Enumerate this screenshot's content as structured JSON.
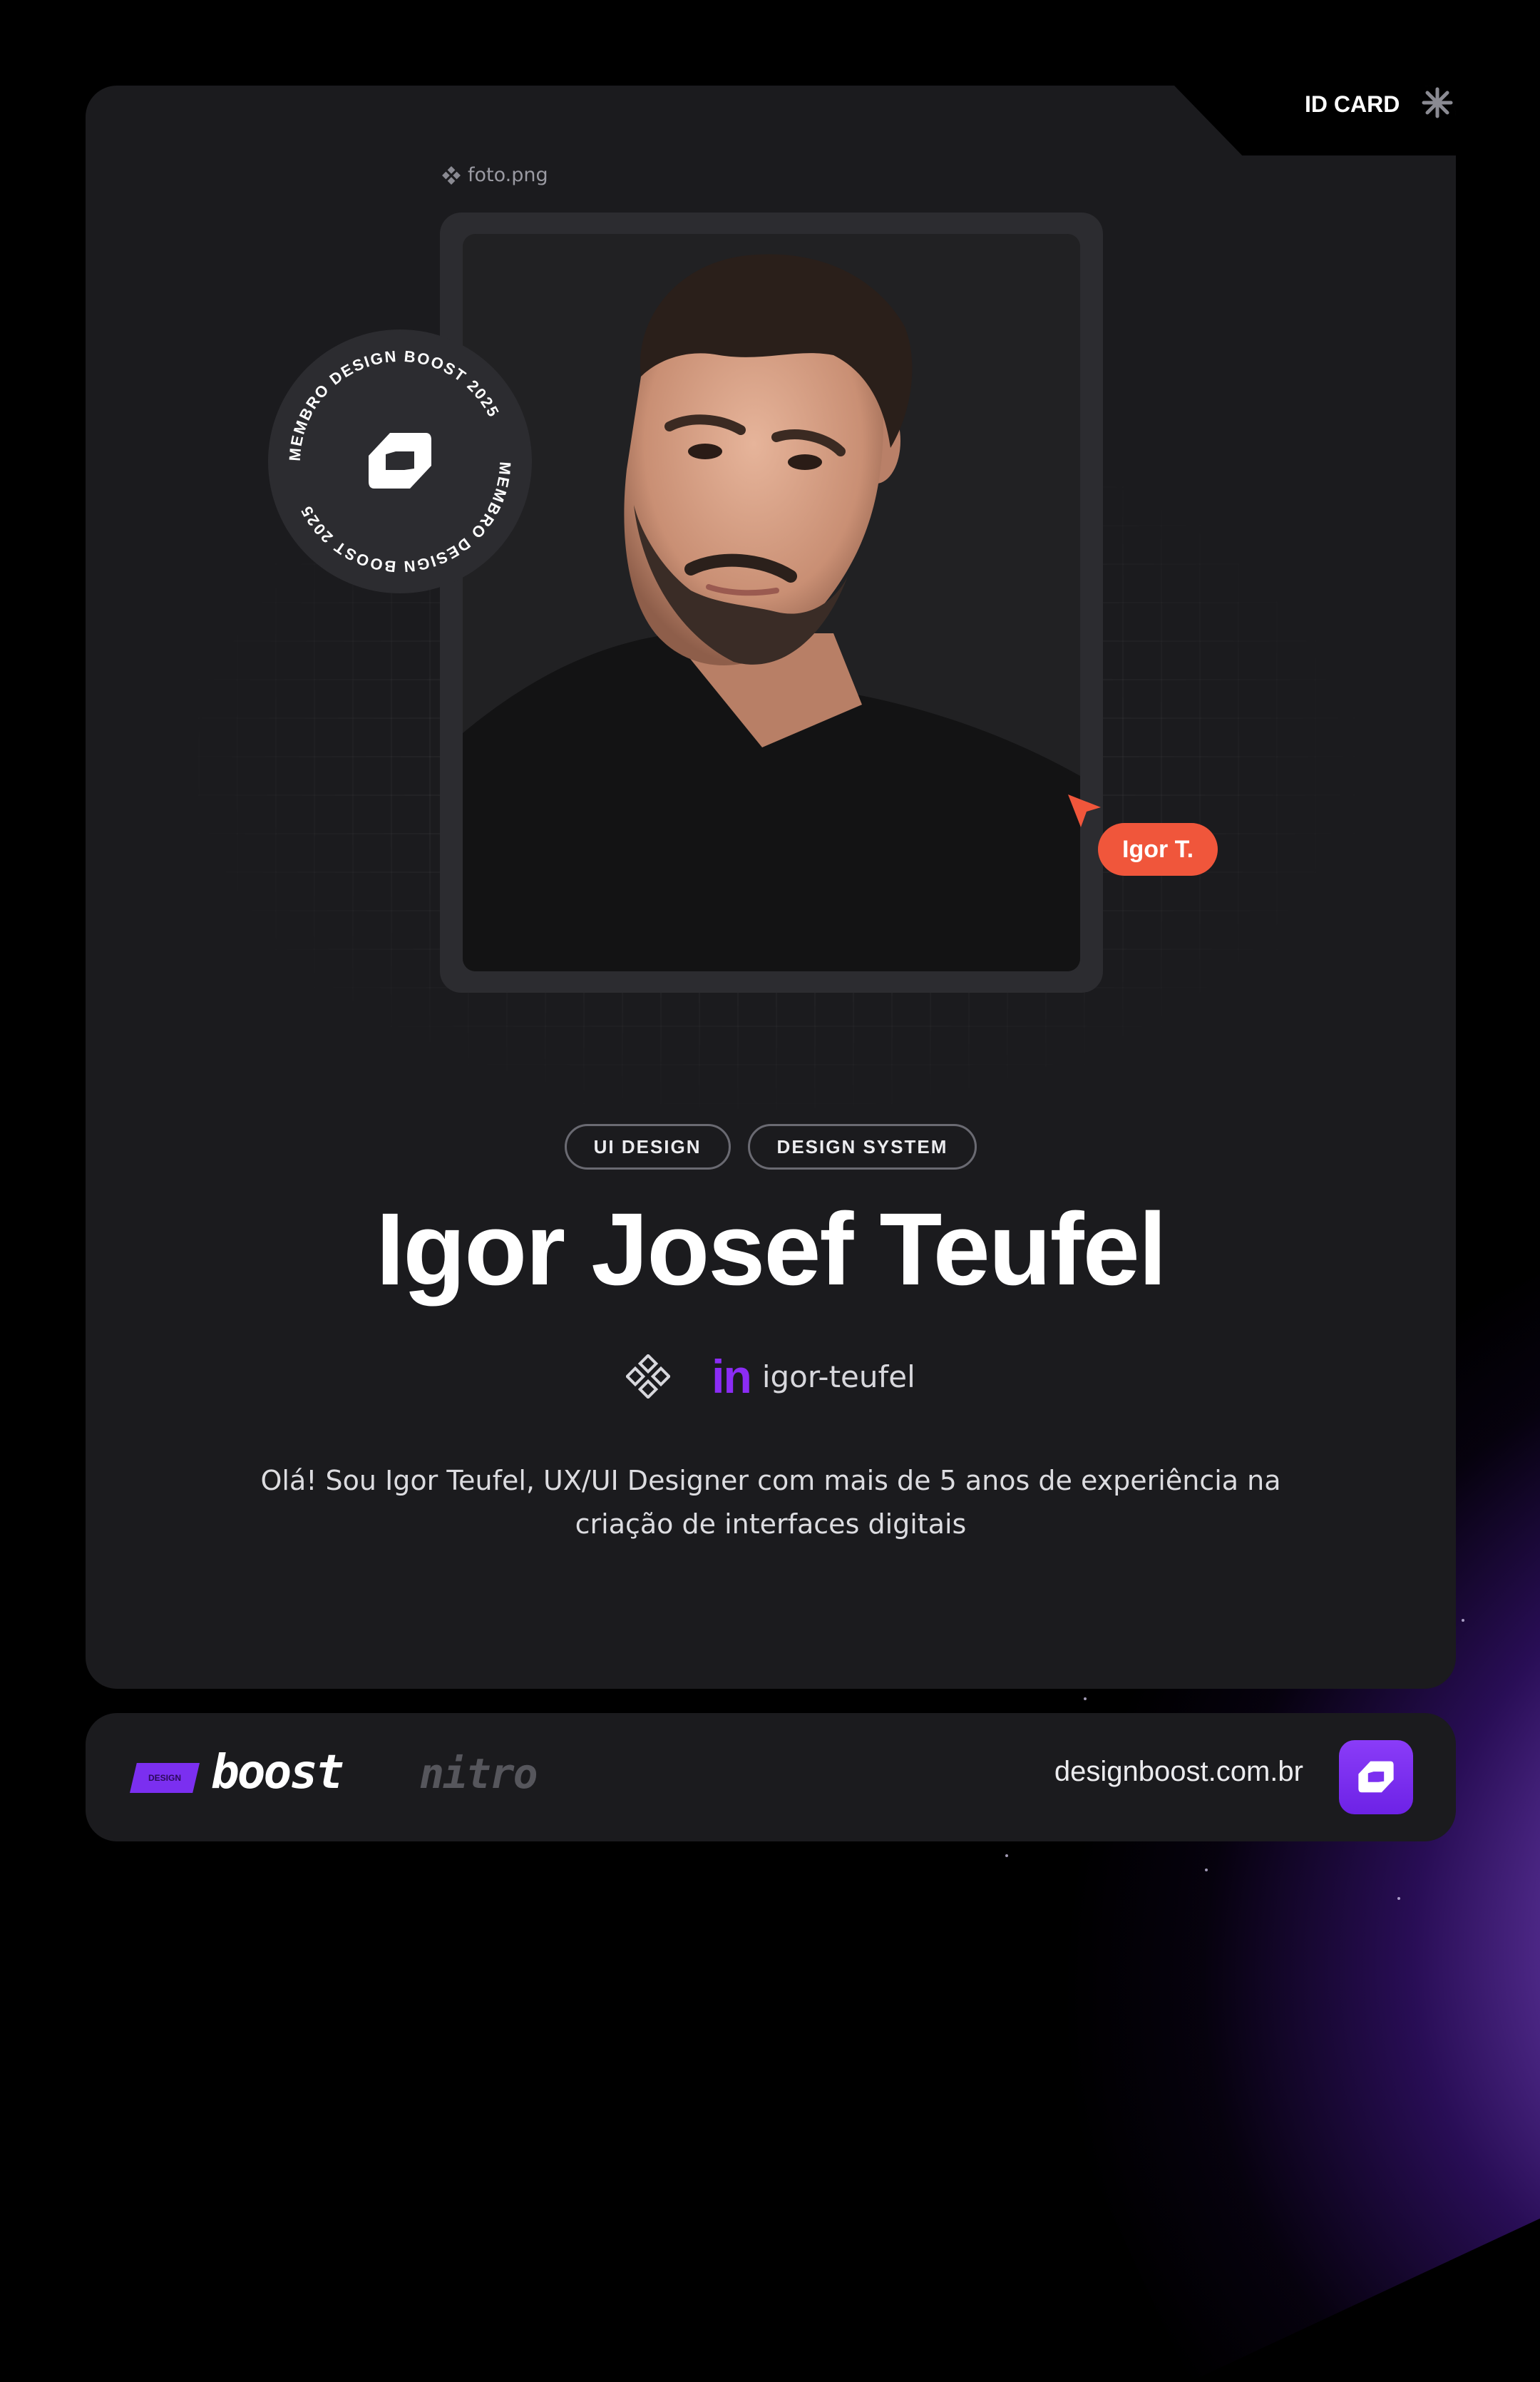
{
  "header": {
    "tab_label": "ID CARD",
    "tab_icon": "asterisk-icon"
  },
  "photo": {
    "file_name": "foto.png",
    "file_icon": "component-icon"
  },
  "badge": {
    "ring_text": "MEMBRO DESIGN BOOST 2025",
    "center_icon": "design-boost-logo-icon"
  },
  "cursor": {
    "label": "Igor T.",
    "color": "#f0563b"
  },
  "profile": {
    "tags": [
      "UI DESIGN",
      "DESIGN SYSTEM"
    ],
    "name": "Igor Josef Teufel",
    "social_icon_1": "figma-icon",
    "linkedin_icon": "in",
    "linkedin_handle": "igor-teufel",
    "bio": "Olá! Sou Igor Teufel, UX/UI Designer com mais de 5 anos de experiência na criação de interfaces digitais"
  },
  "footer": {
    "logo_design": "DESIGN",
    "logo_boost": "boost",
    "logo_nitro": "nitro",
    "site": "designboost.com.br",
    "accent": "#7b2ff0"
  }
}
